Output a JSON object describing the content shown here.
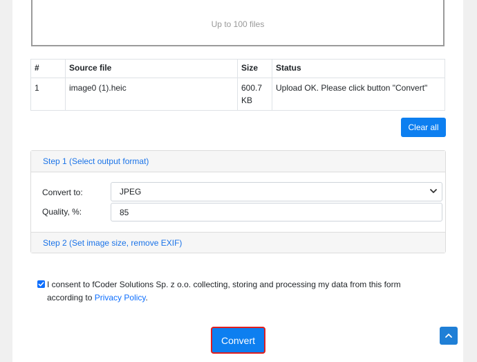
{
  "dropzone": {
    "hint": "Up to 100 files"
  },
  "files_table": {
    "headers": [
      "#",
      "Source file",
      "Size",
      "Status"
    ],
    "rows": [
      {
        "num": "1",
        "source": "image0 (1).heic",
        "size": "600.7 KB",
        "status": "Upload OK. Please click button \"Convert\""
      }
    ]
  },
  "actions": {
    "clear_all": "Clear all",
    "convert": "Convert"
  },
  "step1": {
    "title": "Step 1 (Select output format)",
    "convert_to_label": "Convert to:",
    "convert_to_value": "JPEG",
    "quality_label": "Quality, %:",
    "quality_value": "85"
  },
  "step2": {
    "title": "Step 2 (Set image size, remove EXIF)"
  },
  "consent": {
    "text": "I consent to fCoder Solutions Sp. z o.o. collecting, storing and processing my data from this form according to ",
    "link": "Privacy Policy",
    "suffix": ".",
    "checked": true
  },
  "icons": {
    "select_chevron": "chevron-down-icon",
    "back_to_top": "chevron-up-icon",
    "checkbox": "check-icon"
  },
  "colors": {
    "primary": "#0d7ff0",
    "highlight_border": "#e11d1d",
    "link": "#1a73e8"
  }
}
